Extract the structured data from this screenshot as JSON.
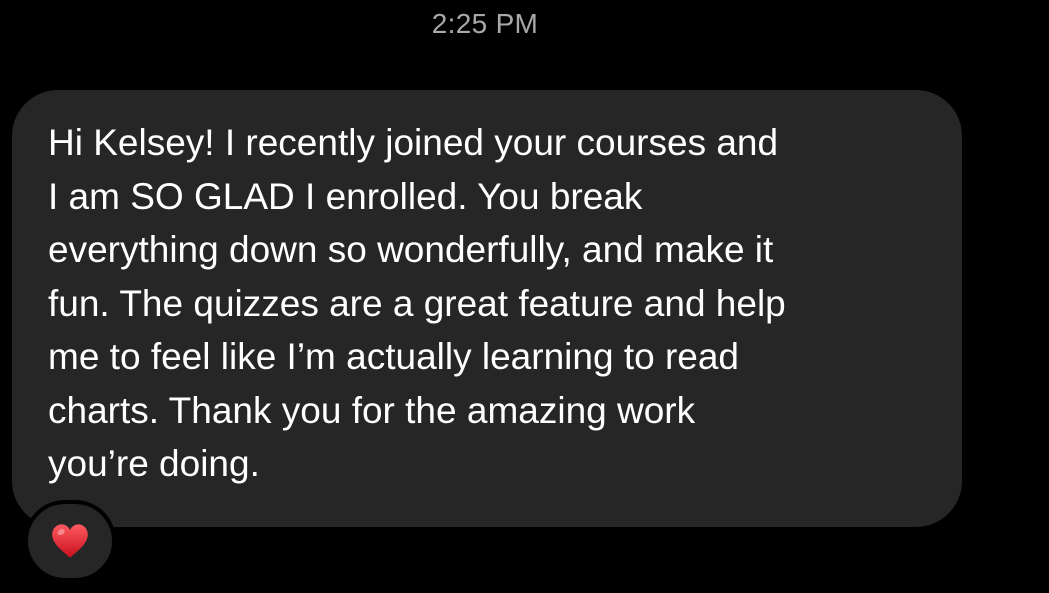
{
  "conversation": {
    "timestamp": "2:25 PM",
    "message": {
      "lines": [
        "Hi Kelsey! I recently joined your courses and",
        "I am SO GLAD I enrolled. You break",
        "everything down so wonderfully, and make it",
        "fun. The quizzes are a great feature and help",
        "me to feel like I’m actually learning to read",
        "charts. Thank you for the amazing work",
        "you’re doing."
      ],
      "bubble_color": "#262626",
      "text_color": "#ffffff"
    },
    "reaction": {
      "icon": "red-heart-icon",
      "color": "#e0242e"
    }
  }
}
